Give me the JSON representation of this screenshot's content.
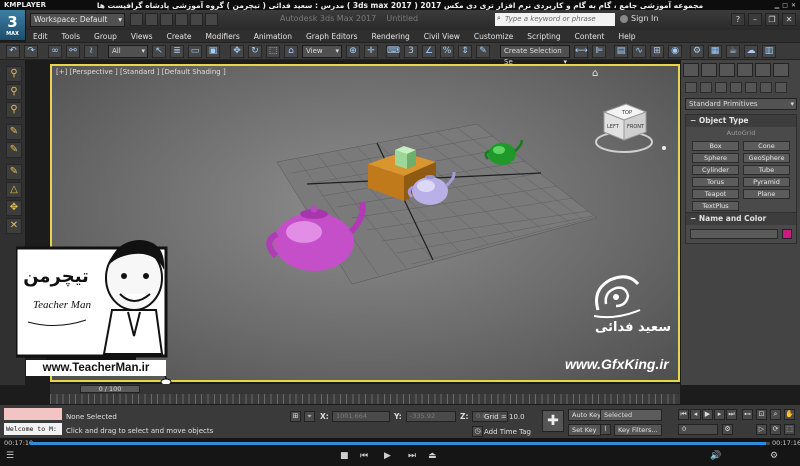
{
  "player": {
    "logo": "KMPLAYER",
    "title": "مجموعه آموزشی جامع ، گام به گام و کاربردی نرم افزار تری دی مکس 2017 ( 3ds max 2017 ) مدرس : سعید فدائی ( تیچرمن ) گروه آموزشی پادشاه گرافیست ها",
    "time_current": "00:17:10",
    "time_total": "00:17:16"
  },
  "app": {
    "logo_number": "3",
    "logo_text": "MAX",
    "title": "Autodesk 3ds Max 2017",
    "document": "Untitled",
    "workspace_label": "Workspace: Default",
    "search_placeholder": "Type a keyword or phrase",
    "sign_in": "Sign In"
  },
  "menu": [
    "Edit",
    "Tools",
    "Group",
    "Views",
    "Create",
    "Modifiers",
    "Animation",
    "Graph Editors",
    "Rendering",
    "Civil View",
    "Customize",
    "Scripting",
    "Content",
    "Help"
  ],
  "toolbar": {
    "selection_filter": "All",
    "ref_coord": "View",
    "named_selection": "Create Selection Se"
  },
  "viewport": {
    "label": "[+] [Perspective ] [Standard ] [Default Shading ]",
    "viewcube": {
      "top": "TOP",
      "left": "LEFT",
      "front": "FRONT"
    },
    "colors": {
      "border": "#e8d44d",
      "teapot_large": "#c44fc9",
      "teapot_small": "#b8b0e6",
      "teapot_green": "#1f9a2a",
      "box": "#c98321",
      "box_small": "#9ed69a"
    }
  },
  "command_panel": {
    "category": "Standard Primitives",
    "object_type_title": "Object Type",
    "autogrid": "AutoGrid",
    "primitives": [
      "Box",
      "Cone",
      "Sphere",
      "GeoSphere",
      "Cylinder",
      "Tube",
      "Torus",
      "Pyramid",
      "Teapot",
      "Plane",
      "TextPlus"
    ],
    "name_color_title": "Name and Color",
    "swatch_color": "#c61d82"
  },
  "timeline": {
    "slider_label": "0 / 100",
    "frame_position": 0
  },
  "status": {
    "welcome": "Welcome to M:",
    "selection": "None Selected",
    "prompt": "Click and drag to select and move objects",
    "x_label": "X:",
    "x_value": "1001.664",
    "y_label": "Y:",
    "y_value": "-335.92",
    "z_label": "Z:",
    "z_value": "0.0",
    "grid": "Grid = 10.0",
    "add_time_tag": "Add Time Tag",
    "auto_key": "Auto Key",
    "selected_dropdown": "Selected",
    "set_key": "Set Key",
    "key_filters": "Key Filters...",
    "frame_field": "0"
  },
  "watermarks": {
    "teacher_logo": "تیچرمن",
    "teacher_name": "Teacher Man",
    "teacher_url": "www.TeacherMan.ir",
    "gfx_name": "سعید فدائی",
    "gfx_url": "www.GfxKing.ir"
  }
}
